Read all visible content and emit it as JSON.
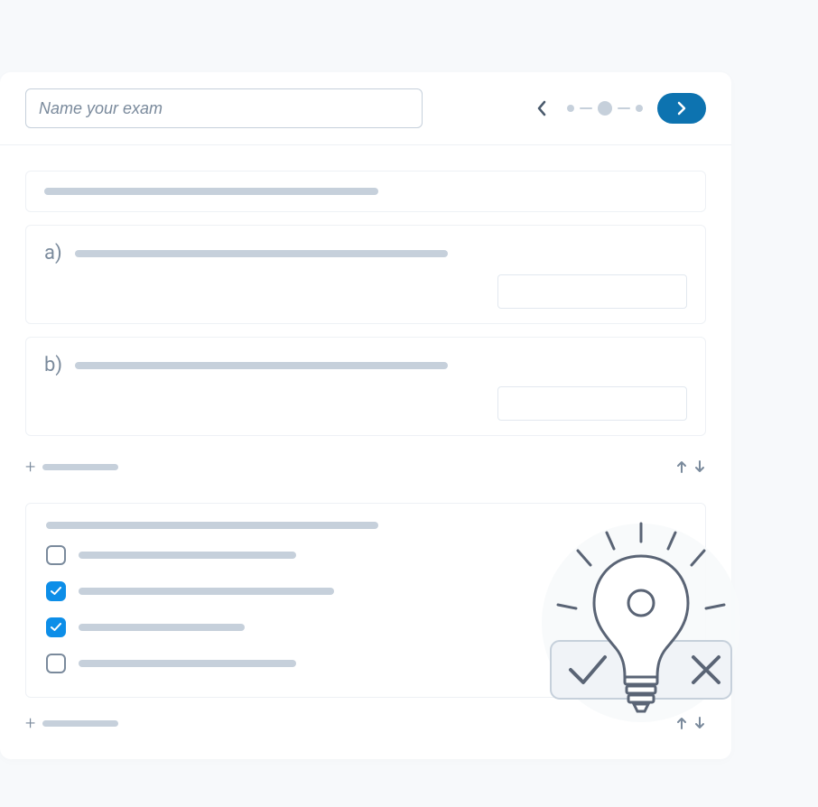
{
  "header": {
    "exam_name_placeholder": "Name your exam",
    "progress_step": 2,
    "progress_total": 3
  },
  "question1": {
    "answers": [
      {
        "label": "a)"
      },
      {
        "label": "b)"
      }
    ],
    "add_label_present": true
  },
  "question2": {
    "options": [
      {
        "checked": false
      },
      {
        "checked": true
      },
      {
        "checked": true
      },
      {
        "checked": false
      }
    ],
    "add_label_present": true
  },
  "icons": {
    "prev": "chevron-left",
    "next": "chevron-right",
    "add": "plus",
    "up": "arrow-up",
    "down": "arrow-down",
    "illustration": "lightbulb-check-x"
  }
}
